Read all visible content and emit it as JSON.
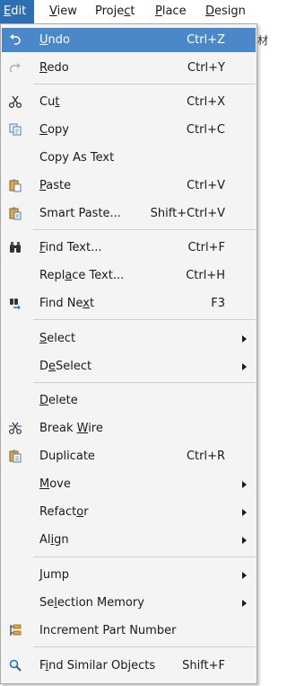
{
  "menubar": {
    "items": [
      {
        "label": "Edit",
        "ul": 0
      },
      {
        "label": "View",
        "ul": 0
      },
      {
        "label": "Project",
        "ul": 5
      },
      {
        "label": "Place",
        "ul": 0
      },
      {
        "label": "Design",
        "ul": 0
      }
    ]
  },
  "background_text": "材",
  "edit_menu": {
    "items": [
      {
        "label": "Undo",
        "ul": 0,
        "shortcut": "Ctrl+Z",
        "icon": "undo-icon",
        "highlighted": true
      },
      {
        "label": "Redo",
        "ul": 0,
        "shortcut": "Ctrl+Y",
        "icon": "redo-icon"
      },
      {
        "label": "Cut",
        "ul": 2,
        "shortcut": "Ctrl+X",
        "icon": "scissors-icon"
      },
      {
        "label": "Copy",
        "ul": 0,
        "shortcut": "Ctrl+C",
        "icon": "copy-icon"
      },
      {
        "label": "Copy As Text",
        "ul": -1,
        "shortcut": "",
        "icon": ""
      },
      {
        "label": "Paste",
        "ul": 0,
        "shortcut": "Ctrl+V",
        "icon": "paste-icon"
      },
      {
        "label": "Smart Paste...",
        "ul": -1,
        "shortcut": "Shift+Ctrl+V",
        "icon": "smart-paste-icon"
      },
      {
        "label": "Find Text...",
        "ul": 0,
        "shortcut": "Ctrl+F",
        "icon": "binoculars-icon"
      },
      {
        "label": "Replace Text...",
        "ul": 4,
        "shortcut": "Ctrl+H",
        "icon": ""
      },
      {
        "label": "Find Next",
        "ul": 7,
        "shortcut": "F3",
        "icon": "find-next-icon"
      },
      {
        "label": "Select",
        "ul": 0,
        "submenu": true
      },
      {
        "label": "DeSelect",
        "ul": 1,
        "submenu": true
      },
      {
        "label": "Delete",
        "ul": 0
      },
      {
        "label": "Break Wire",
        "ul": 6,
        "icon": "break-wire-icon"
      },
      {
        "label": "Duplicate",
        "ul": -1,
        "shortcut": "Ctrl+R",
        "icon": "duplicate-icon"
      },
      {
        "label": "Move",
        "ul": 0,
        "submenu": true
      },
      {
        "label": "Refactor",
        "ul": 6,
        "submenu": true
      },
      {
        "label": "Align",
        "ul": 2,
        "submenu": true
      },
      {
        "label": "Jump",
        "ul": 0,
        "submenu": true
      },
      {
        "label": "Selection Memory",
        "ul": 2,
        "submenu": true
      },
      {
        "label": "Increment Part Number",
        "ul": -1,
        "icon": "increment-icon"
      },
      {
        "label": "Find Similar Objects",
        "ul": 1,
        "shortcut": "Shift+F",
        "icon": "magnifier-icon"
      }
    ]
  }
}
